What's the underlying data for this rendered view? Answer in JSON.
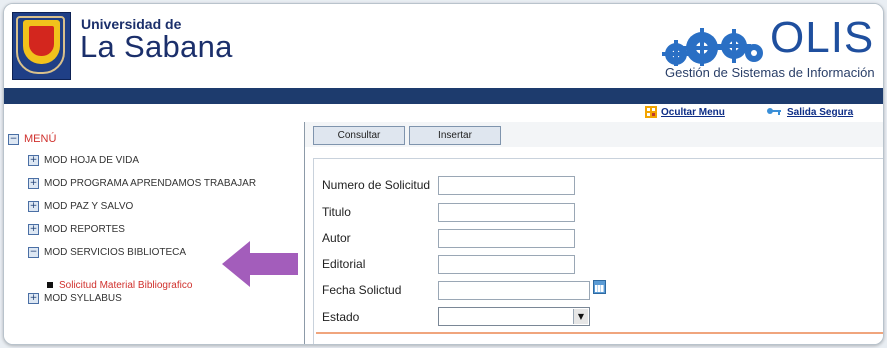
{
  "header": {
    "university_line1": "Universidad de",
    "university_line2": "La Sabana",
    "brand": "OLIS",
    "brand_subtitle": "Gestión de Sistemas de Información"
  },
  "navbar": {
    "hide_menu_label": "Ocultar Menu",
    "secure_exit_label": "Salida Segura"
  },
  "sidebar": {
    "menu_title": "MENÚ",
    "items": [
      {
        "label": "MOD HOJA DE VIDA",
        "toggle": "+"
      },
      {
        "label": "MOD PROGRAMA APRENDAMOS TRABAJAR",
        "toggle": "+"
      },
      {
        "label": "MOD PAZ Y SALVO",
        "toggle": "+"
      },
      {
        "label": "MOD REPORTES",
        "toggle": "+"
      },
      {
        "label": "MOD SERVICIOS BIBLIOTECA",
        "toggle": "−"
      },
      {
        "label": "MOD SYLLABUS",
        "toggle": "+"
      }
    ],
    "sub_item": "Solicitud Material Bibliografico"
  },
  "toolbar": {
    "consult_label": "Consultar",
    "insert_label": "Insertar"
  },
  "form": {
    "request_number_label": "Numero de Solicitud",
    "title_label": "Titulo",
    "author_label": "Autor",
    "publisher_label": "Editorial",
    "request_date_label": "Fecha Solictud",
    "status_label": "Estado",
    "status_value": ""
  },
  "colors": {
    "navbar": "#1d3b6d",
    "accent_red": "#d0312d",
    "arrow": "#a35dbb",
    "brand_blue": "#1f4f9e"
  }
}
